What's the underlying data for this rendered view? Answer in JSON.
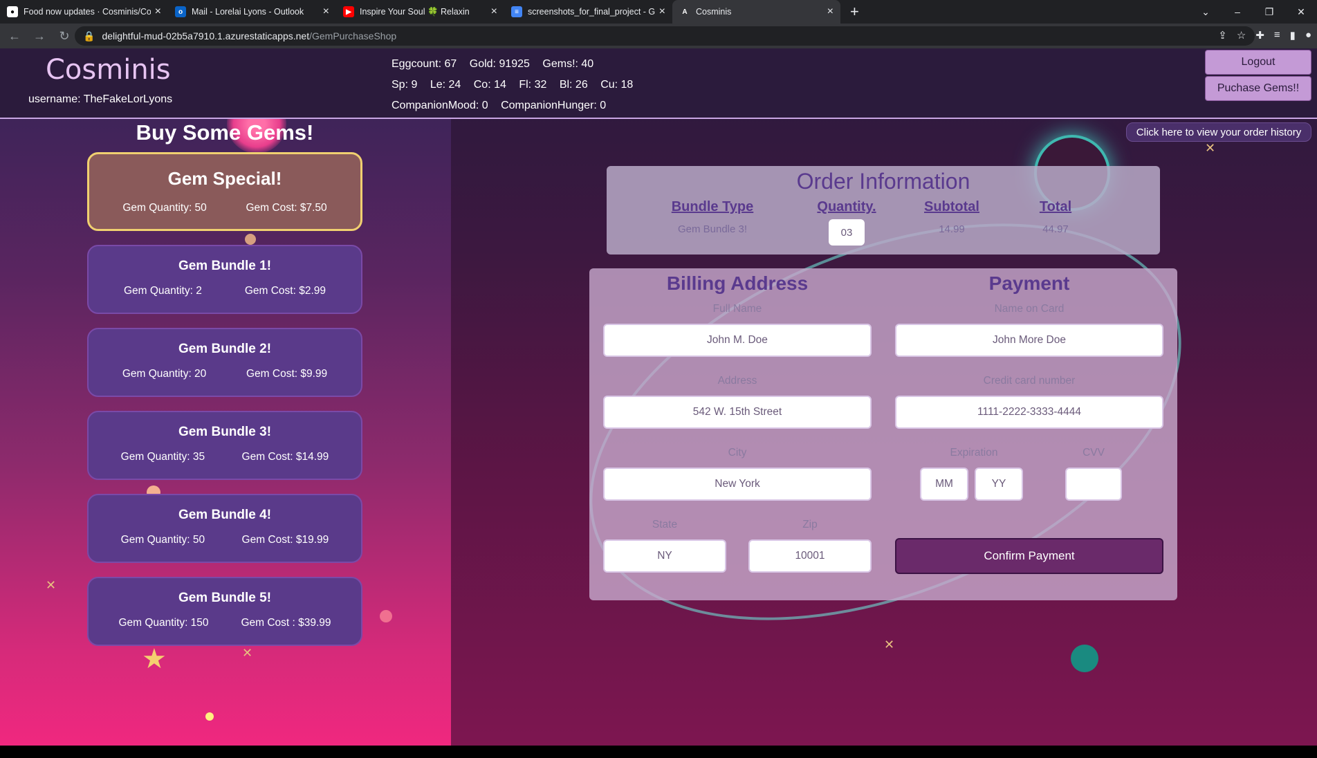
{
  "browser": {
    "tabs": [
      {
        "title": "Food now updates · Cosminis/Co",
        "fav": "github-icon"
      },
      {
        "title": "Mail - Lorelai Lyons - Outlook",
        "fav": "outlook-icon"
      },
      {
        "title": "Inspire Your Soul 🍀 Relaxin",
        "fav": "youtube-icon"
      },
      {
        "title": "screenshots_for_final_project - G",
        "fav": "docs-icon"
      },
      {
        "title": "Cosminis",
        "fav": "azure-icon"
      }
    ],
    "url_host": "delightful-mud-02b5a7910.1.azurestaticapps.net",
    "url_path": "/GemPurchaseShop"
  },
  "header": {
    "logo": "Cosminis",
    "username": "username: TheFakeLorLyons",
    "stats_row1": [
      "Eggcount: 67",
      "Gold: 91925",
      "Gems!: 40"
    ],
    "stats_row2": [
      "Sp: 9",
      "Le: 24",
      "Co: 14",
      "Fl: 32",
      "Bl: 26",
      "Cu: 18"
    ],
    "stats_row3": [
      "CompanionMood: 0",
      "CompanionHunger: 0"
    ],
    "logout": "Logout",
    "purchase_gems": "Puchase Gems!!",
    "order_history": "Click here to view your order history"
  },
  "shop": {
    "title": "Buy Some Gems!",
    "bundles": [
      {
        "name": "Gem Special!",
        "qty": "Gem Quantity: 50",
        "cost": "Gem Cost: $7.50"
      },
      {
        "name": "Gem Bundle 1!",
        "qty": "Gem Quantity: 2",
        "cost": "Gem Cost: $2.99"
      },
      {
        "name": "Gem Bundle 2!",
        "qty": "Gem Quantity: 20",
        "cost": "Gem Cost: $9.99"
      },
      {
        "name": "Gem Bundle 3!",
        "qty": "Gem Quantity: 35",
        "cost": "Gem Cost: $14.99"
      },
      {
        "name": "Gem Bundle 4!",
        "qty": "Gem Quantity: 50",
        "cost": "Gem Cost: $19.99"
      },
      {
        "name": "Gem Bundle 5!",
        "qty": "Gem Quantity: 150",
        "cost": "Gem Cost : $39.99"
      }
    ]
  },
  "order": {
    "title": "Order Information",
    "headers": {
      "bundle": "Bundle Type",
      "quantity": "Quantity.",
      "subtotal": "Subtotal",
      "total": "Total"
    },
    "bundle": "Gem Bundle 3!",
    "quantity": "03",
    "subtotal": "14.99",
    "total": "44.97"
  },
  "billing": {
    "title": "Billing Address",
    "full_name_label": "Full Name",
    "full_name_ph": "John M. Doe",
    "address_label": "Address",
    "address_ph": "542 W. 15th Street",
    "city_label": "City",
    "city_ph": "New York",
    "state_label": "State",
    "state_ph": "NY",
    "zip_label": "Zip",
    "zip_ph": "10001"
  },
  "payment": {
    "title": "Payment",
    "name_label": "Name on Card",
    "name_ph": "John More Doe",
    "cc_label": "Credit card number",
    "cc_ph": "1111-2222-3333-4444",
    "exp_label": "Expiration",
    "mm_ph": "MM",
    "yy_ph": "YY",
    "cvv_label": "CVV",
    "confirm": "Confirm Payment"
  }
}
